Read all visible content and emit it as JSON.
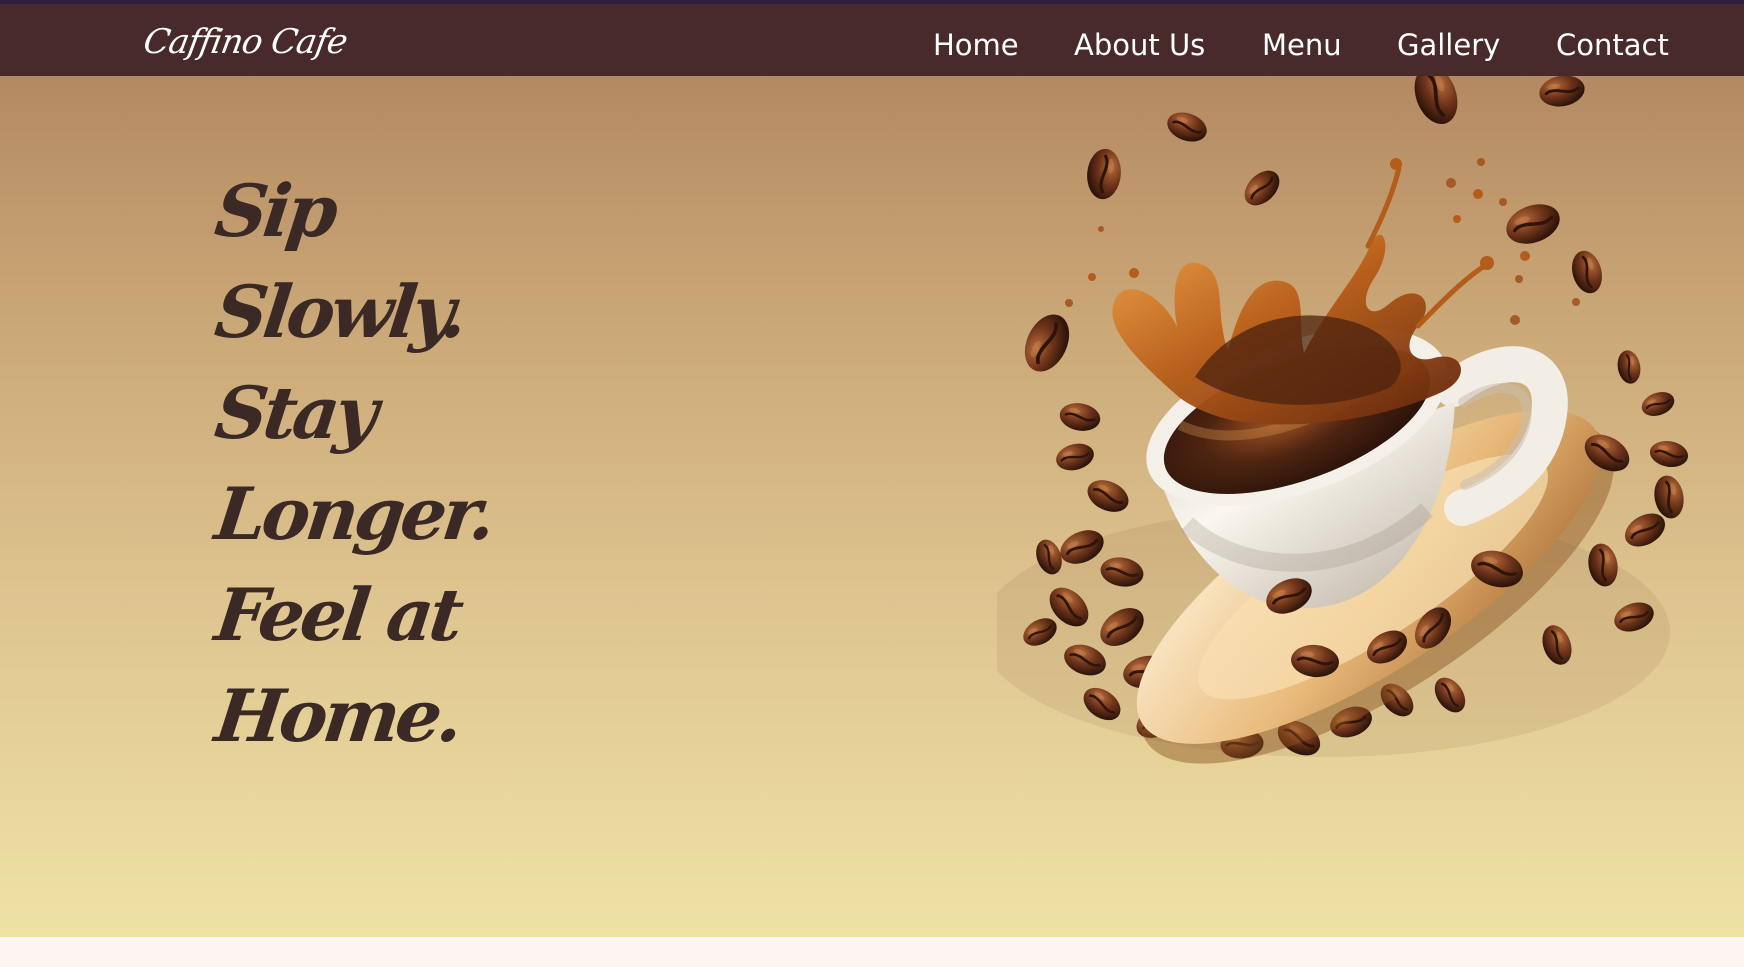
{
  "header": {
    "brand": "Caffino Cafe",
    "nav_items": [
      "Home",
      "About Us",
      "Menu",
      "Gallery",
      "Contact"
    ]
  },
  "hero": {
    "headline_lines": [
      "Sip",
      "Slowly.",
      "Stay",
      "Longer.",
      "Feel at",
      "Home."
    ],
    "image_icon": "coffee-cup-with-splash-and-beans"
  },
  "colors": {
    "nav_background": "#482a2a",
    "hero_gradient_top": "#b38962",
    "hero_gradient_bottom": "#efe2a5",
    "headline_text": "#3a2925",
    "coffee_bean": "#6b3018",
    "coffee_splash": "#b85c17",
    "cup": "#f2eee8",
    "saucer": "#d9aa6d"
  }
}
